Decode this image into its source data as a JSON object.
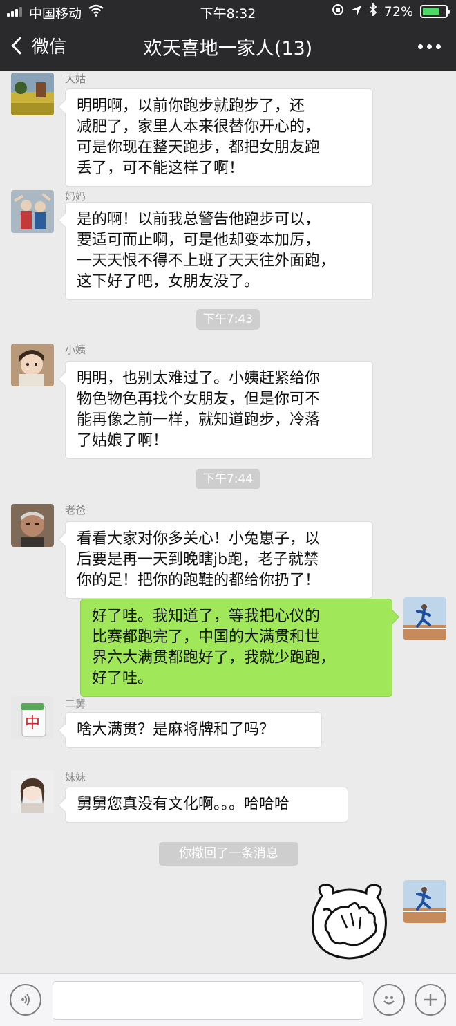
{
  "status_bar": {
    "carrier": "中国移动",
    "time": "下午8:32",
    "battery": "72%",
    "battery_level": 0.72
  },
  "nav": {
    "back_label": "微信",
    "title": "欢天喜地一家人(13)"
  },
  "messages": [
    {
      "sender": "大姑",
      "text": [
        "明明啊，以前你跑步就跑步了，还",
        "减肥了，家里人本来很替你开心的，",
        "可是你现在整天跑步，都把女朋友跑",
        "丢了，可不能这样了啊！"
      ]
    },
    {
      "sender": "妈妈",
      "text": [
        "是的啊！以前我总警告他跑步可以，",
        "要适可而止啊，可是他却变本加厉，",
        "一天天恨不得不上班了天天往外面跑，",
        "这下好了吧，女朋友没了。"
      ]
    },
    {
      "timestamp": "下午7:43"
    },
    {
      "sender": "小姨",
      "text": [
        "明明，也别太难过了。小姨赶紧给你",
        "物色物色再找个女朋友，但是你可不",
        "能再像之前一样，就知道跑步，冷落",
        "了姑娘了啊！"
      ]
    },
    {
      "timestamp": "下午7:44"
    },
    {
      "sender": "老爸",
      "text": [
        "看看大家对你多关心！小兔崽子，以",
        "后要是再一天到晚瞎jb跑，老子就禁",
        "你的足！把你的跑鞋的都给你扔了！"
      ]
    },
    {
      "self": true,
      "text": [
        "好了哇。我知道了，等我把心仪的",
        "比赛都跑完了，中国的大满贯和世",
        "界六大满贯都跑好了，我就少跑跑，",
        "好了哇。"
      ]
    },
    {
      "sender": "二舅",
      "text": [
        "啥大满贯？是麻将牌和了吗？"
      ]
    },
    {
      "sender": "妹妹",
      "text": [
        "舅舅您真没有文化啊。。。哈哈哈"
      ]
    },
    {
      "system": "你撤回了一条消息"
    },
    {
      "self": true,
      "sticker": "facepalm-bear-sticker"
    }
  ],
  "icons": {
    "back": "chevron-left-icon",
    "more": "more-dots-icon",
    "voice": "voice-icon",
    "emoji": "emoji-icon",
    "add": "plus-icon",
    "sticker_glyph": "中"
  },
  "colors": {
    "nav_bg": "#2a2a2d",
    "chat_bg": "#ebebeb",
    "self_bubble": "#a0e75a",
    "other_bubble": "#ffffff",
    "battery_fill": "#4cd964"
  },
  "input": {
    "value": ""
  }
}
